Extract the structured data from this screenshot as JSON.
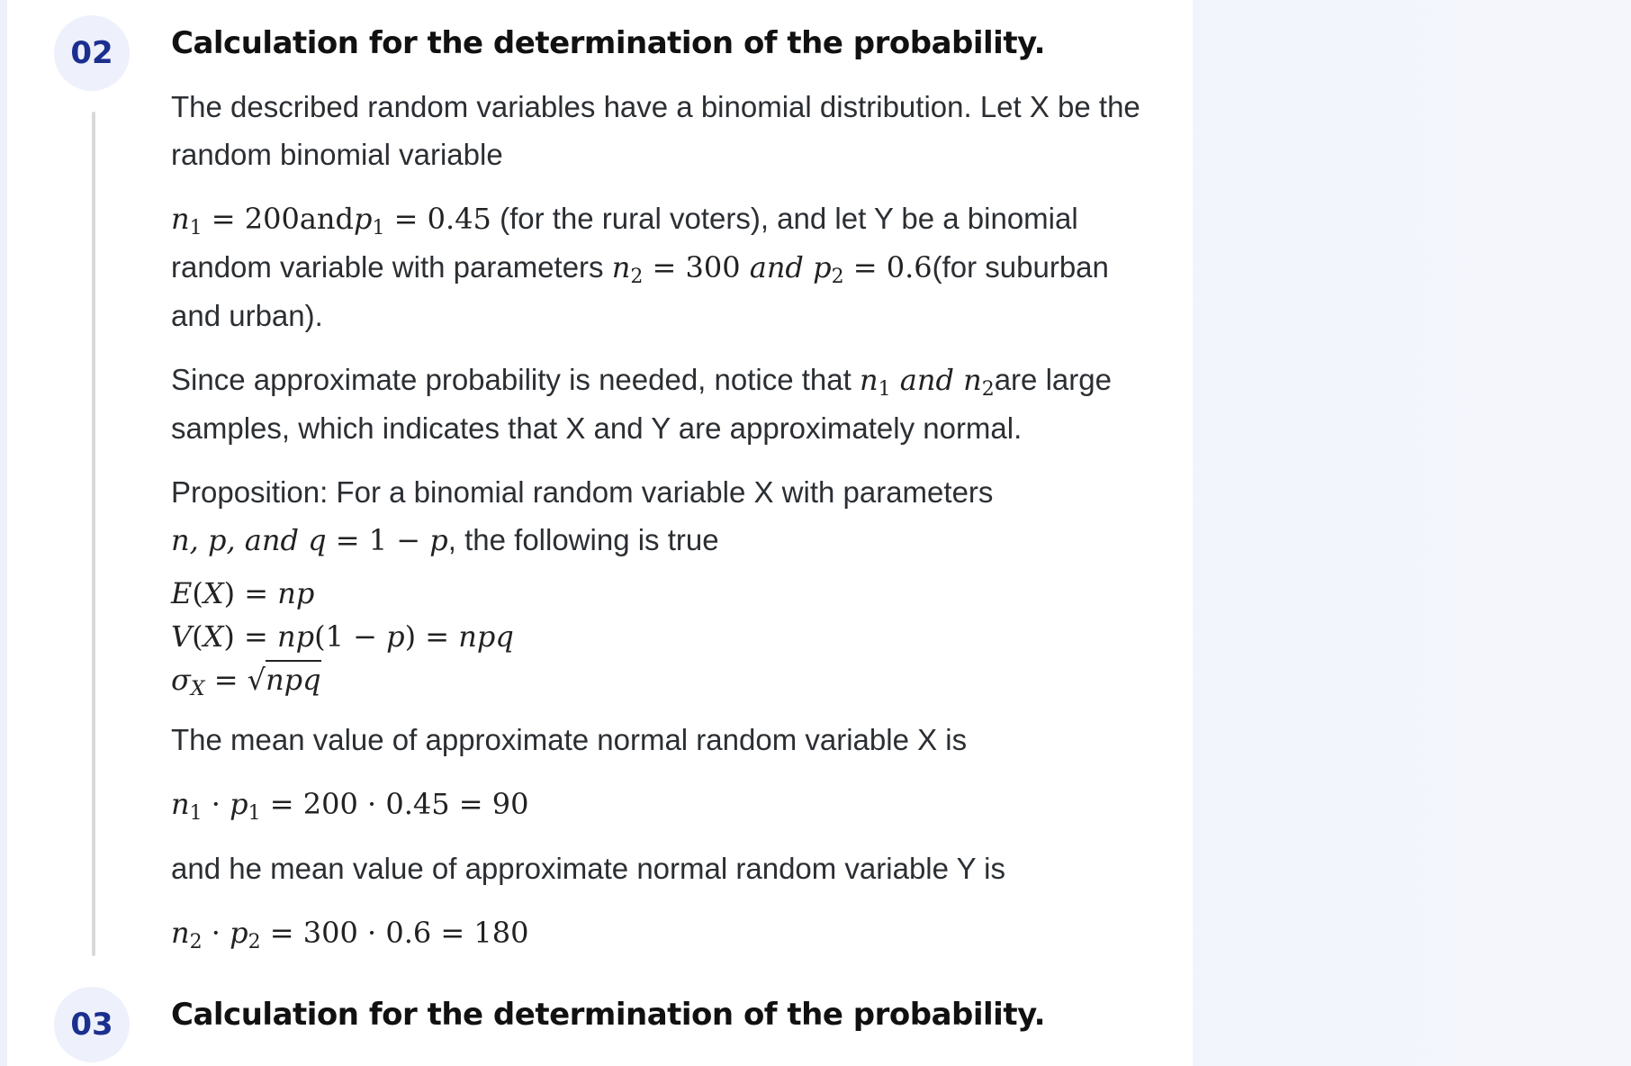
{
  "steps": [
    {
      "number": "02",
      "title": "Calculation for the determination of the probability."
    },
    {
      "number": "03",
      "title": "Calculation for the determination of the probability."
    }
  ],
  "body": {
    "p1": "The described random variables have a binomial distribution. Let X be the random binomial variable",
    "p2_math1": "n₁ = 200andp₁ = 0.45",
    "p2_text1": " (for the rural voters), and let Y be a binomial random variable with parameters ",
    "p2_math2": "n₂ = 300 and p₂ = 0.6",
    "p2_text2": "(for suburban and urban).",
    "p3_text1": "Since approximate probability is needed, notice that ",
    "p3_math": "n₁ and n₂",
    "p3_text2": "are large samples, which indicates that X and Y are approximately normal.",
    "p4_text1": "Proposition: For a binomial random variable X with parameters",
    "p4_math": "n, p, and q = 1 − p",
    "p4_text2": ", the following is true",
    "formula_ex": "E(X) = np",
    "formula_vx": "V(X) = np(1 − p) = npq",
    "formula_sigma": "σX = √npq",
    "p5": "The mean value of approximate normal random variable X is",
    "calc_x": "n₁ · p₁ = 200 · 0.45 = 90",
    "p6": "and he mean value of approximate normal random variable Y is",
    "calc_y": "n₂ · p₂ = 300 · 0.6 = 180"
  }
}
